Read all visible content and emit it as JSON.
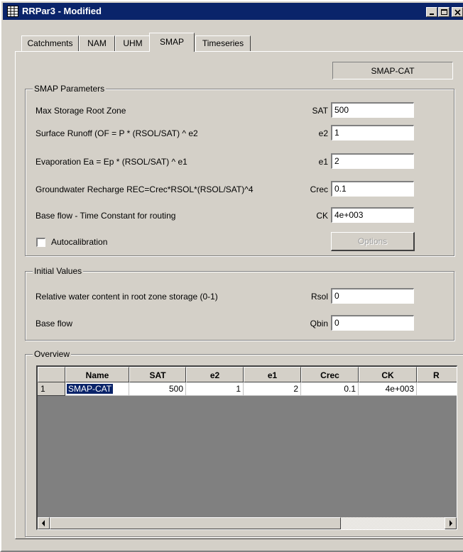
{
  "window": {
    "title": "RRPar3 - Modified"
  },
  "tabs": [
    {
      "label": "Catchments"
    },
    {
      "label": "NAM"
    },
    {
      "label": "UHM"
    },
    {
      "label": "SMAP"
    },
    {
      "label": "Timeseries"
    }
  ],
  "active_tab": "SMAP",
  "catchment_badge": "SMAP-CAT",
  "smap_parameters": {
    "title": "SMAP Parameters",
    "rows": [
      {
        "label": "Max Storage Root Zone",
        "param": "SAT",
        "value": "500"
      },
      {
        "label": "Surface Runoff (OF = P * (RSOL/SAT) ^ e2",
        "param": "e2",
        "value": "1"
      },
      {
        "label": "Evaporation  Ea = Ep * (RSOL/SAT) ^ e1",
        "param": "e1",
        "value": "2"
      },
      {
        "label": "Groundwater Recharge REC=Crec*RSOL*(RSOL/SAT)^4",
        "param": "Crec",
        "value": "0.1"
      },
      {
        "label": "Base flow - Time Constant for routing",
        "param": "CK",
        "value": "4e+003"
      }
    ],
    "autocalibration_label": "Autocalibration",
    "autocalibration_checked": false,
    "options_label": "Options"
  },
  "initial_values": {
    "title": "Initial Values",
    "rows": [
      {
        "label": "Relative water content in root zone storage (0-1)",
        "param": "Rsol",
        "value": "0"
      },
      {
        "label": "Base flow",
        "param": "Qbin",
        "value": "0"
      }
    ]
  },
  "overview": {
    "title": "Overview",
    "columns": [
      "Name",
      "SAT",
      "e2",
      "e1",
      "Crec",
      "CK",
      "R"
    ],
    "rows": [
      {
        "index": "1",
        "cells": [
          "SMAP-CAT",
          "500",
          "1",
          "2",
          "0.1",
          "4e+003",
          ""
        ]
      }
    ]
  },
  "colors": {
    "titlebar": "#0a246a",
    "face": "#d4d0c8",
    "selection": "#0a246a"
  }
}
